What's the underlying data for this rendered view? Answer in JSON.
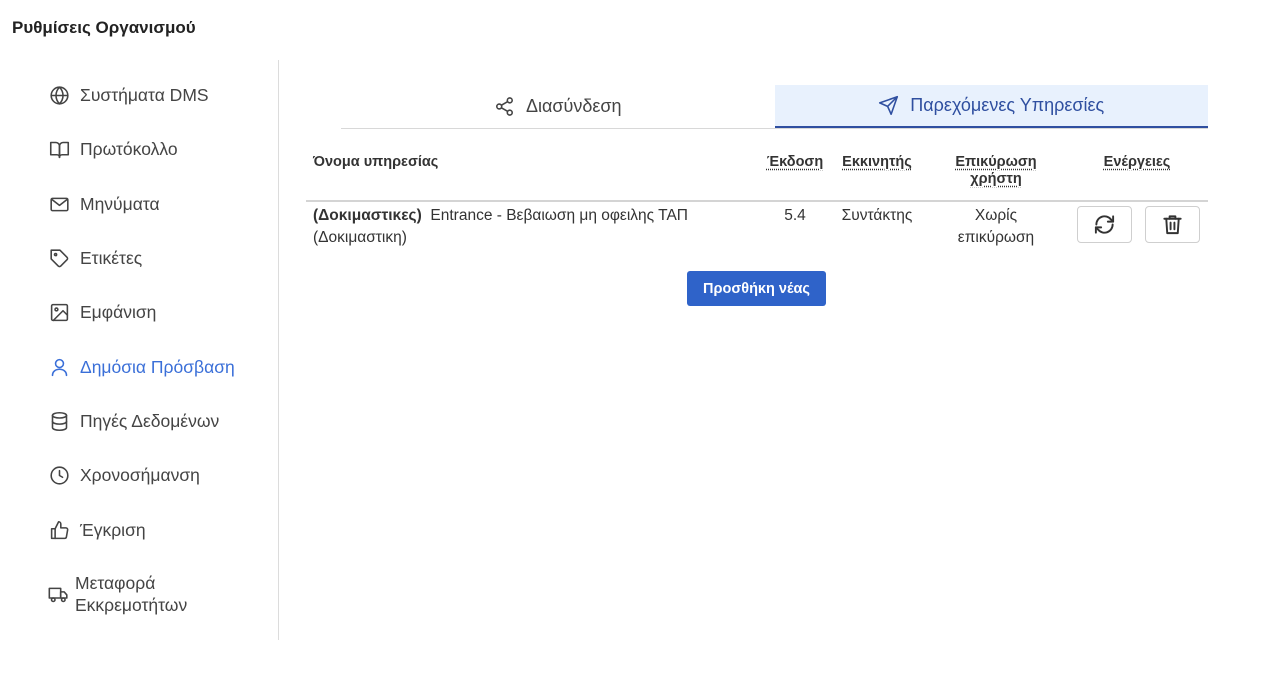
{
  "page": {
    "title": "Ρυθμίσεις Οργανισμού"
  },
  "sidebar": {
    "items": [
      {
        "label": "Συστήματα DMS",
        "icon": "globe-icon"
      },
      {
        "label": "Πρωτόκολλο",
        "icon": "book-icon"
      },
      {
        "label": "Μηνύματα",
        "icon": "mail-icon"
      },
      {
        "label": "Ετικέτες",
        "icon": "tag-icon"
      },
      {
        "label": "Εμφάνιση",
        "icon": "image-icon"
      },
      {
        "label": "Δημόσια Πρόσβαση",
        "icon": "user-icon",
        "active": true
      },
      {
        "label": "Πηγές Δεδομένων",
        "icon": "database-icon"
      },
      {
        "label": "Χρονοσήμανση",
        "icon": "clock-icon"
      },
      {
        "label": "Έγκριση",
        "icon": "thumbs-up-icon"
      },
      {
        "label": "Μεταφορά Εκκρεμοτήτων",
        "icon": "truck-icon"
      }
    ]
  },
  "tabs": [
    {
      "label": "Διασύνδεση",
      "icon": "share-icon"
    },
    {
      "label": "Παρεχόμενες Υπηρεσίες",
      "icon": "send-icon",
      "active": true
    }
  ],
  "table": {
    "headers": {
      "name": "Όνομα υπηρεσίας",
      "version": "Έκδοση",
      "initiator": "Εκκινητής",
      "auth_line1": "Επικύρωση",
      "auth_line2": "χρήστη",
      "actions": "Ενέργειες"
    },
    "rows": [
      {
        "name_prefix": "(Δοκιμαστικες)",
        "name_line1": "Entrance - Βεβαιωση μη οφειλης ΤΑΠ",
        "name_line2": "(Δοκιμαστικη)",
        "version": "5.4",
        "initiator": "Συντάκτης",
        "auth_line1": "Χωρίς",
        "auth_line2": "επικύρωση"
      }
    ]
  },
  "add_button": {
    "label": "Προσθήκη νέας"
  },
  "colors": {
    "accent": "#2f63c9",
    "active_tab_bg": "#e8f1fd",
    "active_link": "#3a6fd8"
  }
}
